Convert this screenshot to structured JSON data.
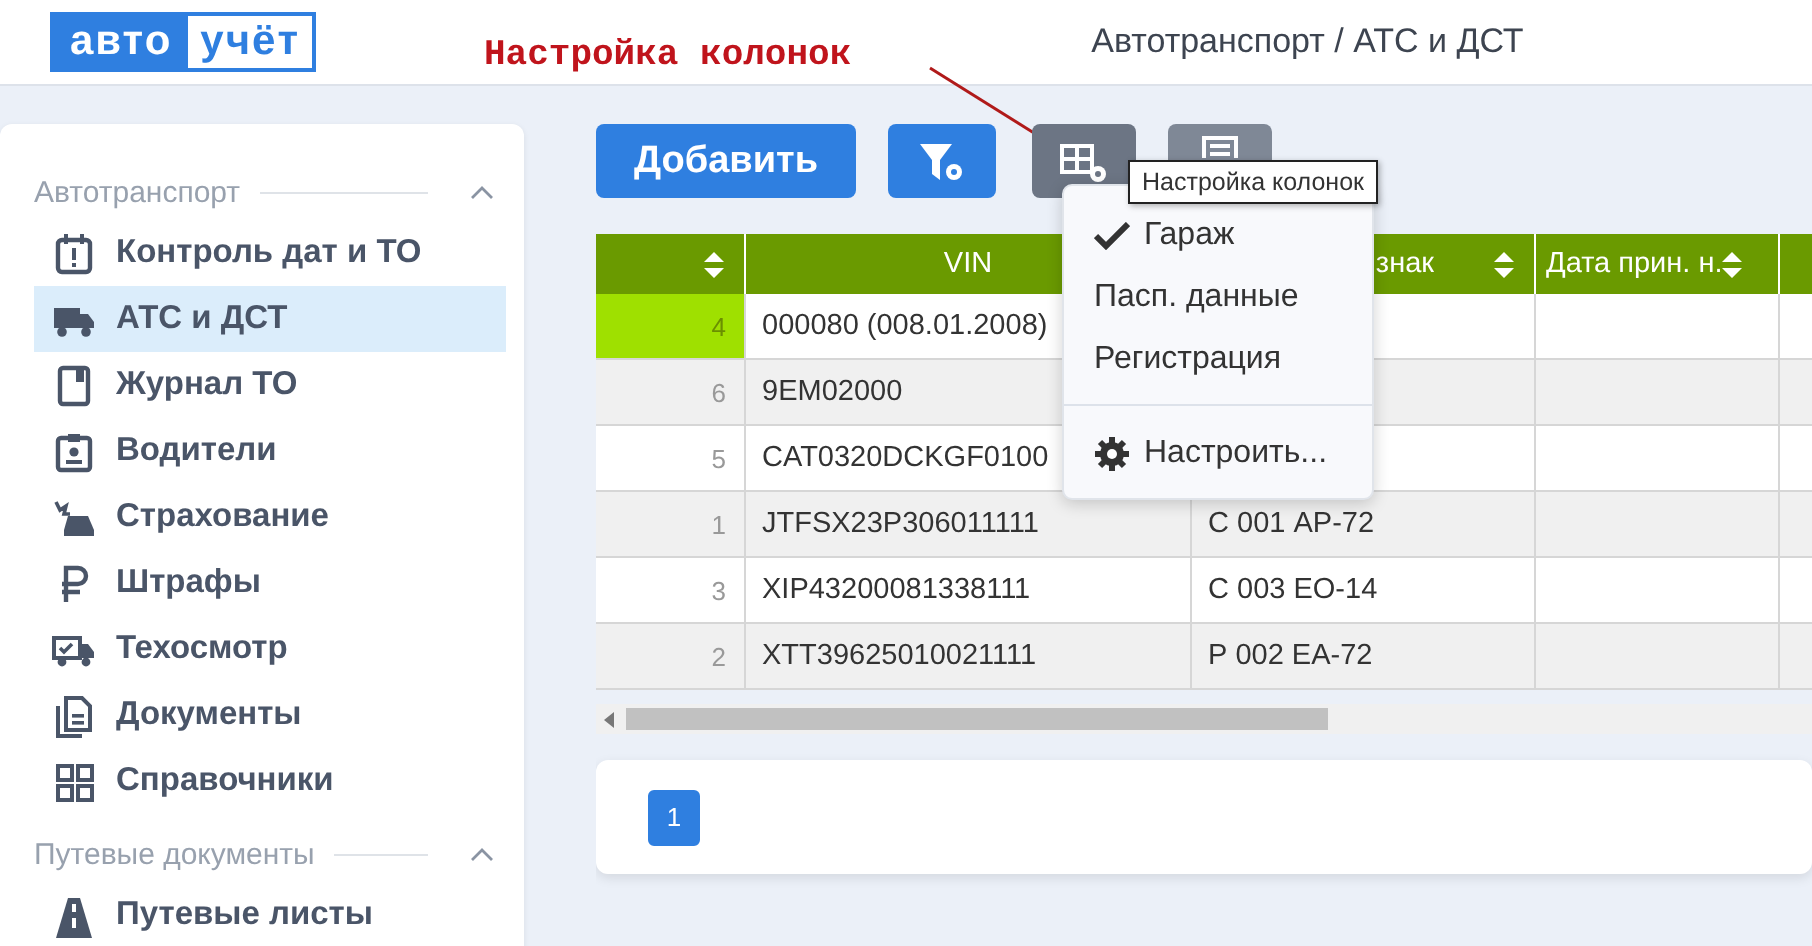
{
  "header": {
    "logo": [
      "авто",
      "учёт"
    ],
    "breadcrumb": "Автотранспорт / АТС и ДСТ"
  },
  "annotation": "Настройка колонок",
  "sidebar": {
    "sections": [
      {
        "title": "Автотранспорт",
        "expanded": true,
        "items": [
          {
            "label": "Контроль дат и ТО",
            "selected": false
          },
          {
            "label": "АТС и ДСТ",
            "selected": true
          },
          {
            "label": "Журнал ТО",
            "selected": false
          },
          {
            "label": "Водители",
            "selected": false
          },
          {
            "label": "Страхование",
            "selected": false
          },
          {
            "label": "Штрафы",
            "selected": false
          },
          {
            "label": "Техосмотр",
            "selected": false
          },
          {
            "label": "Документы",
            "selected": false
          },
          {
            "label": "Справочники",
            "selected": false
          }
        ]
      },
      {
        "title": "Путевые документы",
        "expanded": true,
        "items": [
          {
            "label": "Путевые листы",
            "selected": false
          }
        ]
      }
    ]
  },
  "toolbar": {
    "add_button": "Добавить"
  },
  "tooltip": "Настройка колонок",
  "column_menu": [
    {
      "kind": "option",
      "label": "Гараж",
      "checked": true
    },
    {
      "kind": "option",
      "label": "Пасп. данные",
      "checked": false
    },
    {
      "kind": "option",
      "label": "Регистрация",
      "checked": false
    },
    {
      "kind": "action",
      "label": "Настроить..."
    }
  ],
  "table": {
    "columns": [
      {
        "sortable": true
      },
      {
        "label": "VIN",
        "sortable": false
      },
      {
        "label": "знак",
        "sortable": true
      },
      {
        "label": "Дата прин. н.",
        "sortable": true
      }
    ],
    "rows": [
      {
        "number": "4",
        "vin": "000080 (008.01.2008)",
        "highlighted": true
      },
      {
        "number": "6",
        "vin": "9EM02000",
        "highlighted": false
      },
      {
        "number": "5",
        "vin": "CAT0320DCKGF0100",
        "highlighted": false
      },
      {
        "number": "1",
        "vin": "JTFSX23P306011111",
        "plate": "С 001 АР-72",
        "highlighted": false
      },
      {
        "number": "3",
        "vin": "XIP43200081338111",
        "plate": "С 003 ЕО-14",
        "highlighted": false
      },
      {
        "number": "2",
        "vin": "XTT39625010021111",
        "plate": "Р 002 ЕА-72",
        "highlighted": false
      }
    ]
  },
  "pagination": [
    {
      "label": "1",
      "selected": true
    }
  ]
}
